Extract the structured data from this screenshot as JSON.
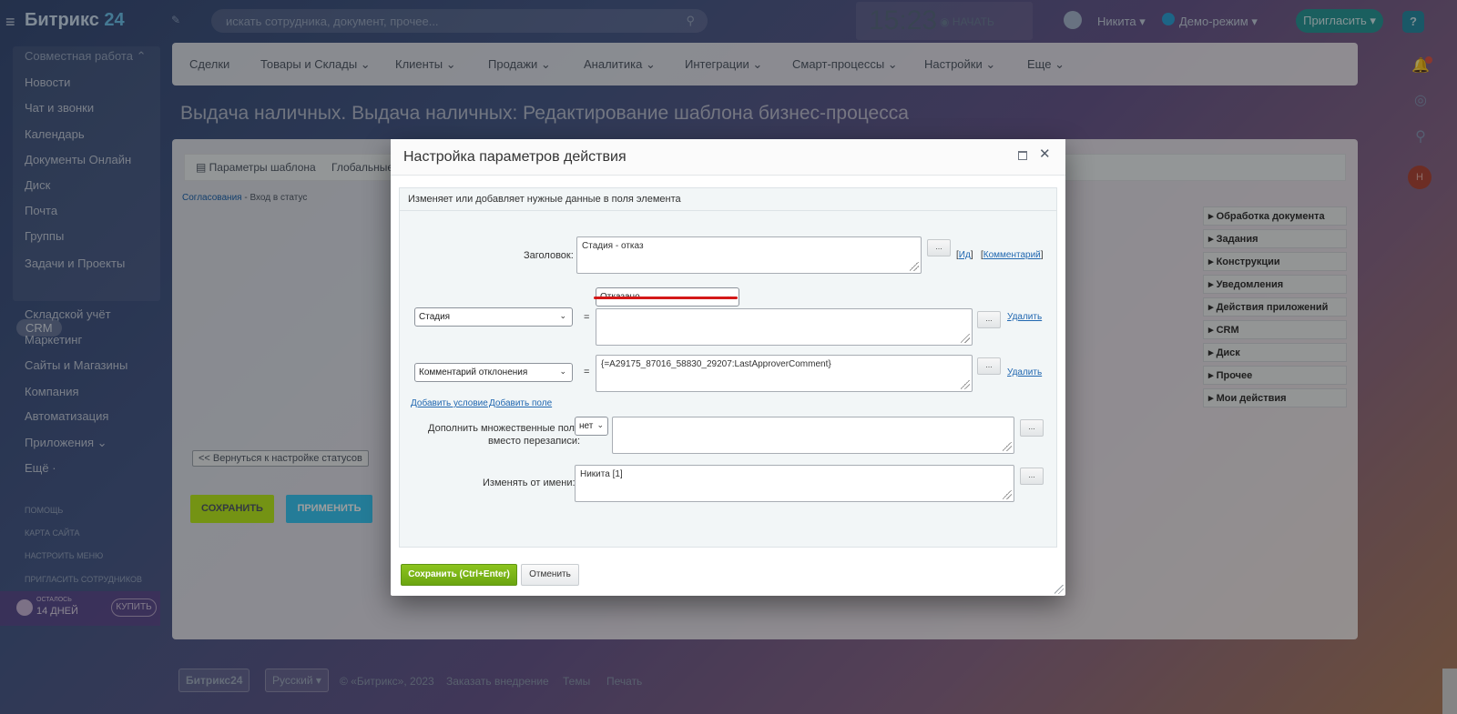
{
  "header": {
    "logo_text": "Битрикс",
    "logo_num": "24",
    "search_placeholder": "искать сотрудника, документ, прочее...",
    "clock_time": "15:23",
    "clock_start": "НАЧАТЬ",
    "user_name": "Никита",
    "demo_label": "Демо-режим",
    "invite_label": "Пригласить",
    "help_label": "?"
  },
  "sidebar": {
    "group_head": "Совместная работа",
    "items": [
      "Новости",
      "Чат и звонки",
      "Календарь",
      "Документы Онлайн",
      "Диск",
      "Почта",
      "Группы",
      "Задачи и Проекты"
    ],
    "crm_label": "CRM",
    "items2": [
      "Складской учёт",
      "Маркетинг",
      "Сайты и Магазины",
      "Компания",
      "Автоматизация",
      "Приложения",
      "Ещё"
    ],
    "small_links": [
      "ПОМОЩЬ",
      "КАРТА САЙТА",
      "НАСТРОИТЬ МЕНЮ",
      "ПРИГЛАСИТЬ СОТРУДНИКОВ"
    ],
    "trial_small": "ОСТАЛОСЬ",
    "trial_big": "14 ДНЕЙ",
    "buy_label": "КУПИТЬ"
  },
  "nav": {
    "items": [
      "Сделки",
      "Товары и Склады",
      "Клиенты",
      "Продажи",
      "Аналитика",
      "Интеграции",
      "Смарт-процессы",
      "Настройки",
      "Еще"
    ]
  },
  "page": {
    "title": "Выдача наличных. Выдача наличных: Редактирование шаблона бизнес-процесса",
    "tabs": [
      "Параметры шаблона",
      "Глобальные"
    ],
    "crumb_link": "Согласования",
    "crumb_rest": " - Вход в статус",
    "back_btn": "<< Вернуться к настройке статусов",
    "save_btn": "СОХРАНИТЬ",
    "apply_btn": "ПРИМЕНИТЬ",
    "right_list": [
      "Обработка документа",
      "Задания",
      "Конструкции",
      "Уведомления",
      "Действия приложений",
      "CRM",
      "Диск",
      "Прочее",
      "Мои действия"
    ]
  },
  "footer": {
    "logo": "Битрикс24",
    "lang": "Русский",
    "copyright": "© «Битрикс», 2023",
    "order": "Заказать внедрение",
    "themes": "Темы",
    "print": "Печать"
  },
  "dialog": {
    "title": "Настройка параметров действия",
    "description": "Изменяет или добавляет нужные данные в поля элемента",
    "title_label": "Заголовок:",
    "title_value": "Стадия - отказ",
    "link_id": "Ид",
    "link_comment": "Комментарий",
    "field1_select": "Стадия",
    "field1_value_select": "Отказано",
    "field1_value": "",
    "field2_select": "Комментарий отклонения",
    "field2_value": "{=A29175_87016_58830_29207:LastApproverComment}",
    "delete_label": "Удалить",
    "add_condition": "Добавить условие",
    "add_field": "Добавить поле",
    "multi_label_1": "Дополнить множественные поля",
    "multi_label_2": "вместо перезаписи:",
    "multi_select": "нет",
    "multi_value": "",
    "modified_by_label": "Изменять от имени:",
    "modified_by_value": "Никита [1]",
    "dots": "...",
    "save_btn": "Сохранить (Ctrl+Enter)",
    "cancel_btn": "Отменить",
    "eq": "="
  }
}
